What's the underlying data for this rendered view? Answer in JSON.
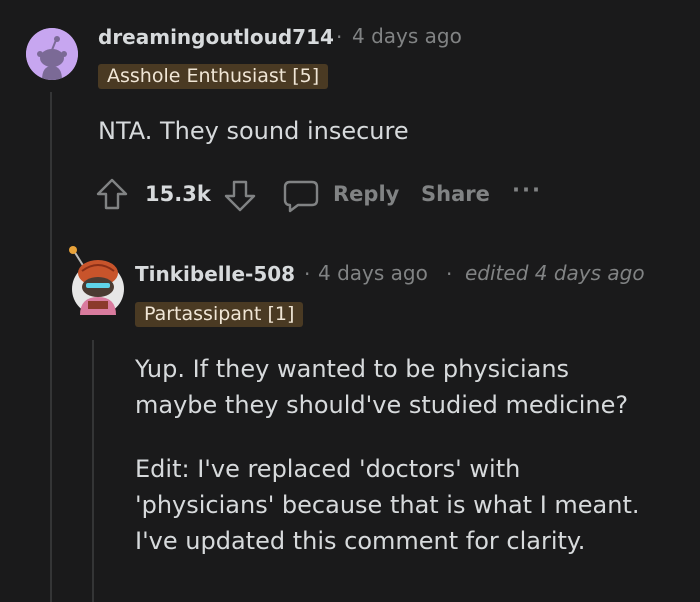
{
  "comment1": {
    "username": "dreamingoutloud714",
    "separator": "·",
    "time": "4 days ago",
    "flair": "Asshole Enthusiast [5]",
    "body": "NTA. They sound insecure",
    "votes": "15.3k",
    "reply_label": "Reply",
    "share_label": "Share",
    "more_label": "···"
  },
  "comment2": {
    "username": "Tinkibelle-508",
    "separator1": "·",
    "time": "4 days ago",
    "separator2": "·",
    "edited": "edited 4 days ago",
    "flair": "Partassipant [1]",
    "para1_line1": "Yup. If they wanted to be physicians",
    "para1_line2": "maybe they should've studied medicine?",
    "para2_line1": "Edit: I've replaced 'doctors' with",
    "para2_line2": "'physicians' because that is what I meant.",
    "para2_line3": "I've updated this comment for clarity."
  },
  "colors": {
    "background": "#1a1a1b",
    "text": "#d7dadc",
    "muted": "#818384",
    "flair_bg": "#4a3a23",
    "avatar1_bg": "#c7a6f0"
  }
}
